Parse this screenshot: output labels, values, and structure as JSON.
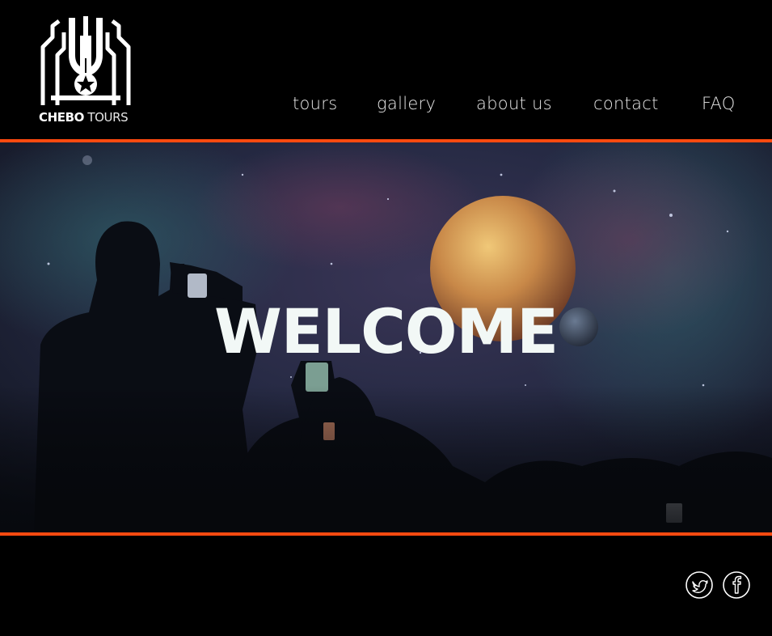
{
  "brand": {
    "name_bold": "CHEBO",
    "name_light": "TOURS",
    "logo_icon": "cathedral-star-icon"
  },
  "nav": {
    "items": [
      {
        "label": "tours"
      },
      {
        "label": "gallery"
      },
      {
        "label": "about us"
      },
      {
        "label": "contact"
      },
      {
        "label": "FAQ"
      }
    ]
  },
  "hero": {
    "headline": "WELCOME"
  },
  "footer": {
    "social": [
      {
        "icon": "twitter-icon"
      },
      {
        "icon": "facebook-icon"
      }
    ]
  },
  "colors": {
    "background": "#000000",
    "accent_rule": "#ff4a10",
    "headline": "#f2f8f6"
  }
}
